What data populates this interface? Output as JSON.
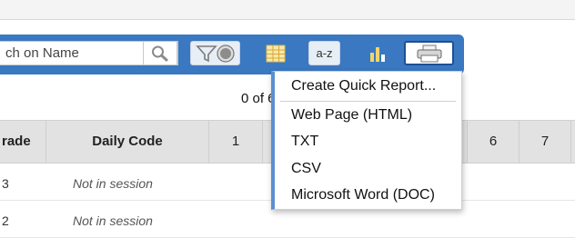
{
  "toolbar": {
    "search_value": "ch on Name",
    "icons": [
      "search-icon",
      "filter-toggle-icon",
      "columns-grid-icon",
      "sort-az-icon",
      "bar-chart-icon",
      "printer-icon"
    ],
    "sort_label": "a-z"
  },
  "count_text": "0 of 6",
  "table": {
    "headers": [
      "rade",
      "Daily Code",
      "1",
      "6",
      "7"
    ],
    "rows": [
      {
        "grade": "3",
        "code": "Not in session"
      },
      {
        "grade": "2",
        "code": "Not in session"
      }
    ]
  },
  "print_menu": {
    "items": [
      "Create Quick Report...",
      "Web Page (HTML)",
      "TXT",
      "CSV",
      "Microsoft Word (DOC)"
    ]
  },
  "colors": {
    "toolbar": "#3a78c2",
    "menu_accent": "#5b8fd0",
    "header_bg": "#e2e2e2"
  }
}
